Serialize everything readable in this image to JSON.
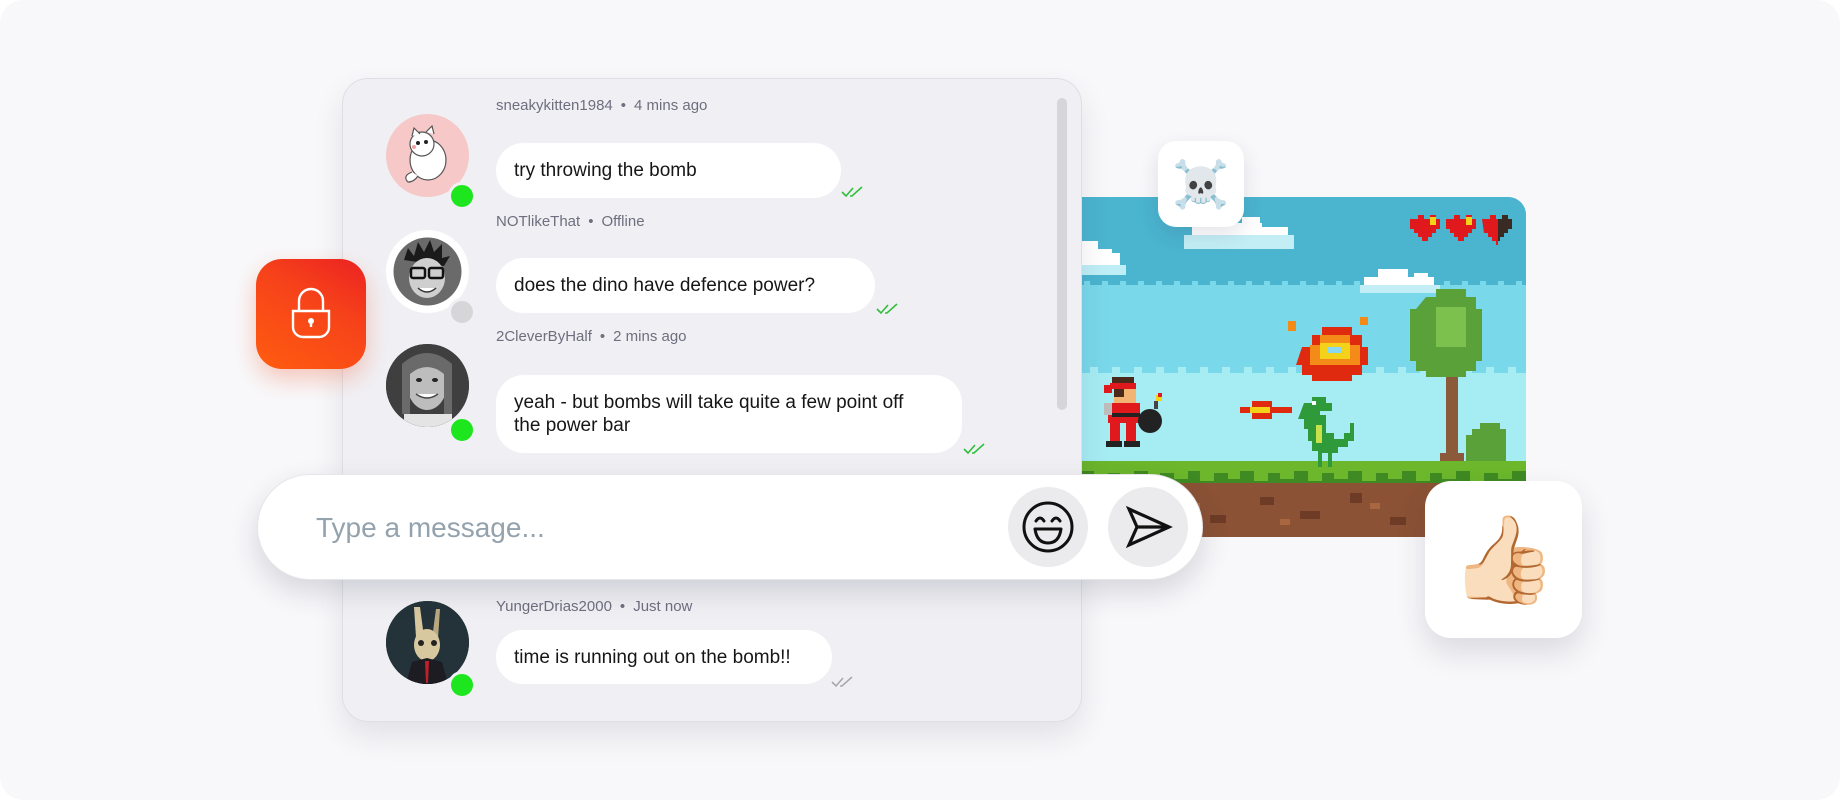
{
  "chat": {
    "messages": [
      {
        "username": "sneakykitten1984",
        "time": "4 mins ago",
        "text": "try throwing the bomb",
        "status": "online",
        "receipt": "read",
        "avatar": "cat-avatar"
      },
      {
        "username": "NOTlikeThat",
        "time": "Offline",
        "text": "does the dino have defence power?",
        "status": "offline",
        "receipt": "read",
        "avatar": "cartoon-man-avatar"
      },
      {
        "username": "2CleverByHalf",
        "time": "2 mins ago",
        "text": "yeah - but bombs will take quite a few point off the power bar",
        "status": "online",
        "receipt": "read",
        "avatar": "woman-photo-avatar"
      },
      {
        "username": "YungerDrias2000",
        "time": "Just now",
        "text": "time is running out on the bomb!!",
        "status": "online",
        "receipt": "delivered",
        "avatar": "rabbit-suit-avatar"
      }
    ],
    "separator": "•"
  },
  "composer": {
    "placeholder": "Type a message...",
    "value": "",
    "emoji_button": "emoji-picker",
    "send_button": "send"
  },
  "reactions": {
    "skull": "☠️",
    "thumbs_up": "👍🏻"
  },
  "game": {
    "health_hearts_total": 3,
    "health_hearts_filled": 2.5
  },
  "colors": {
    "online": "#1ee61e",
    "offline": "#d6d6d8",
    "read_tick": "#2fbf3a",
    "delivered_tick": "#a8a8b0",
    "lock_gradient_start": "#ff5c10",
    "lock_gradient_end": "#ec2222"
  }
}
